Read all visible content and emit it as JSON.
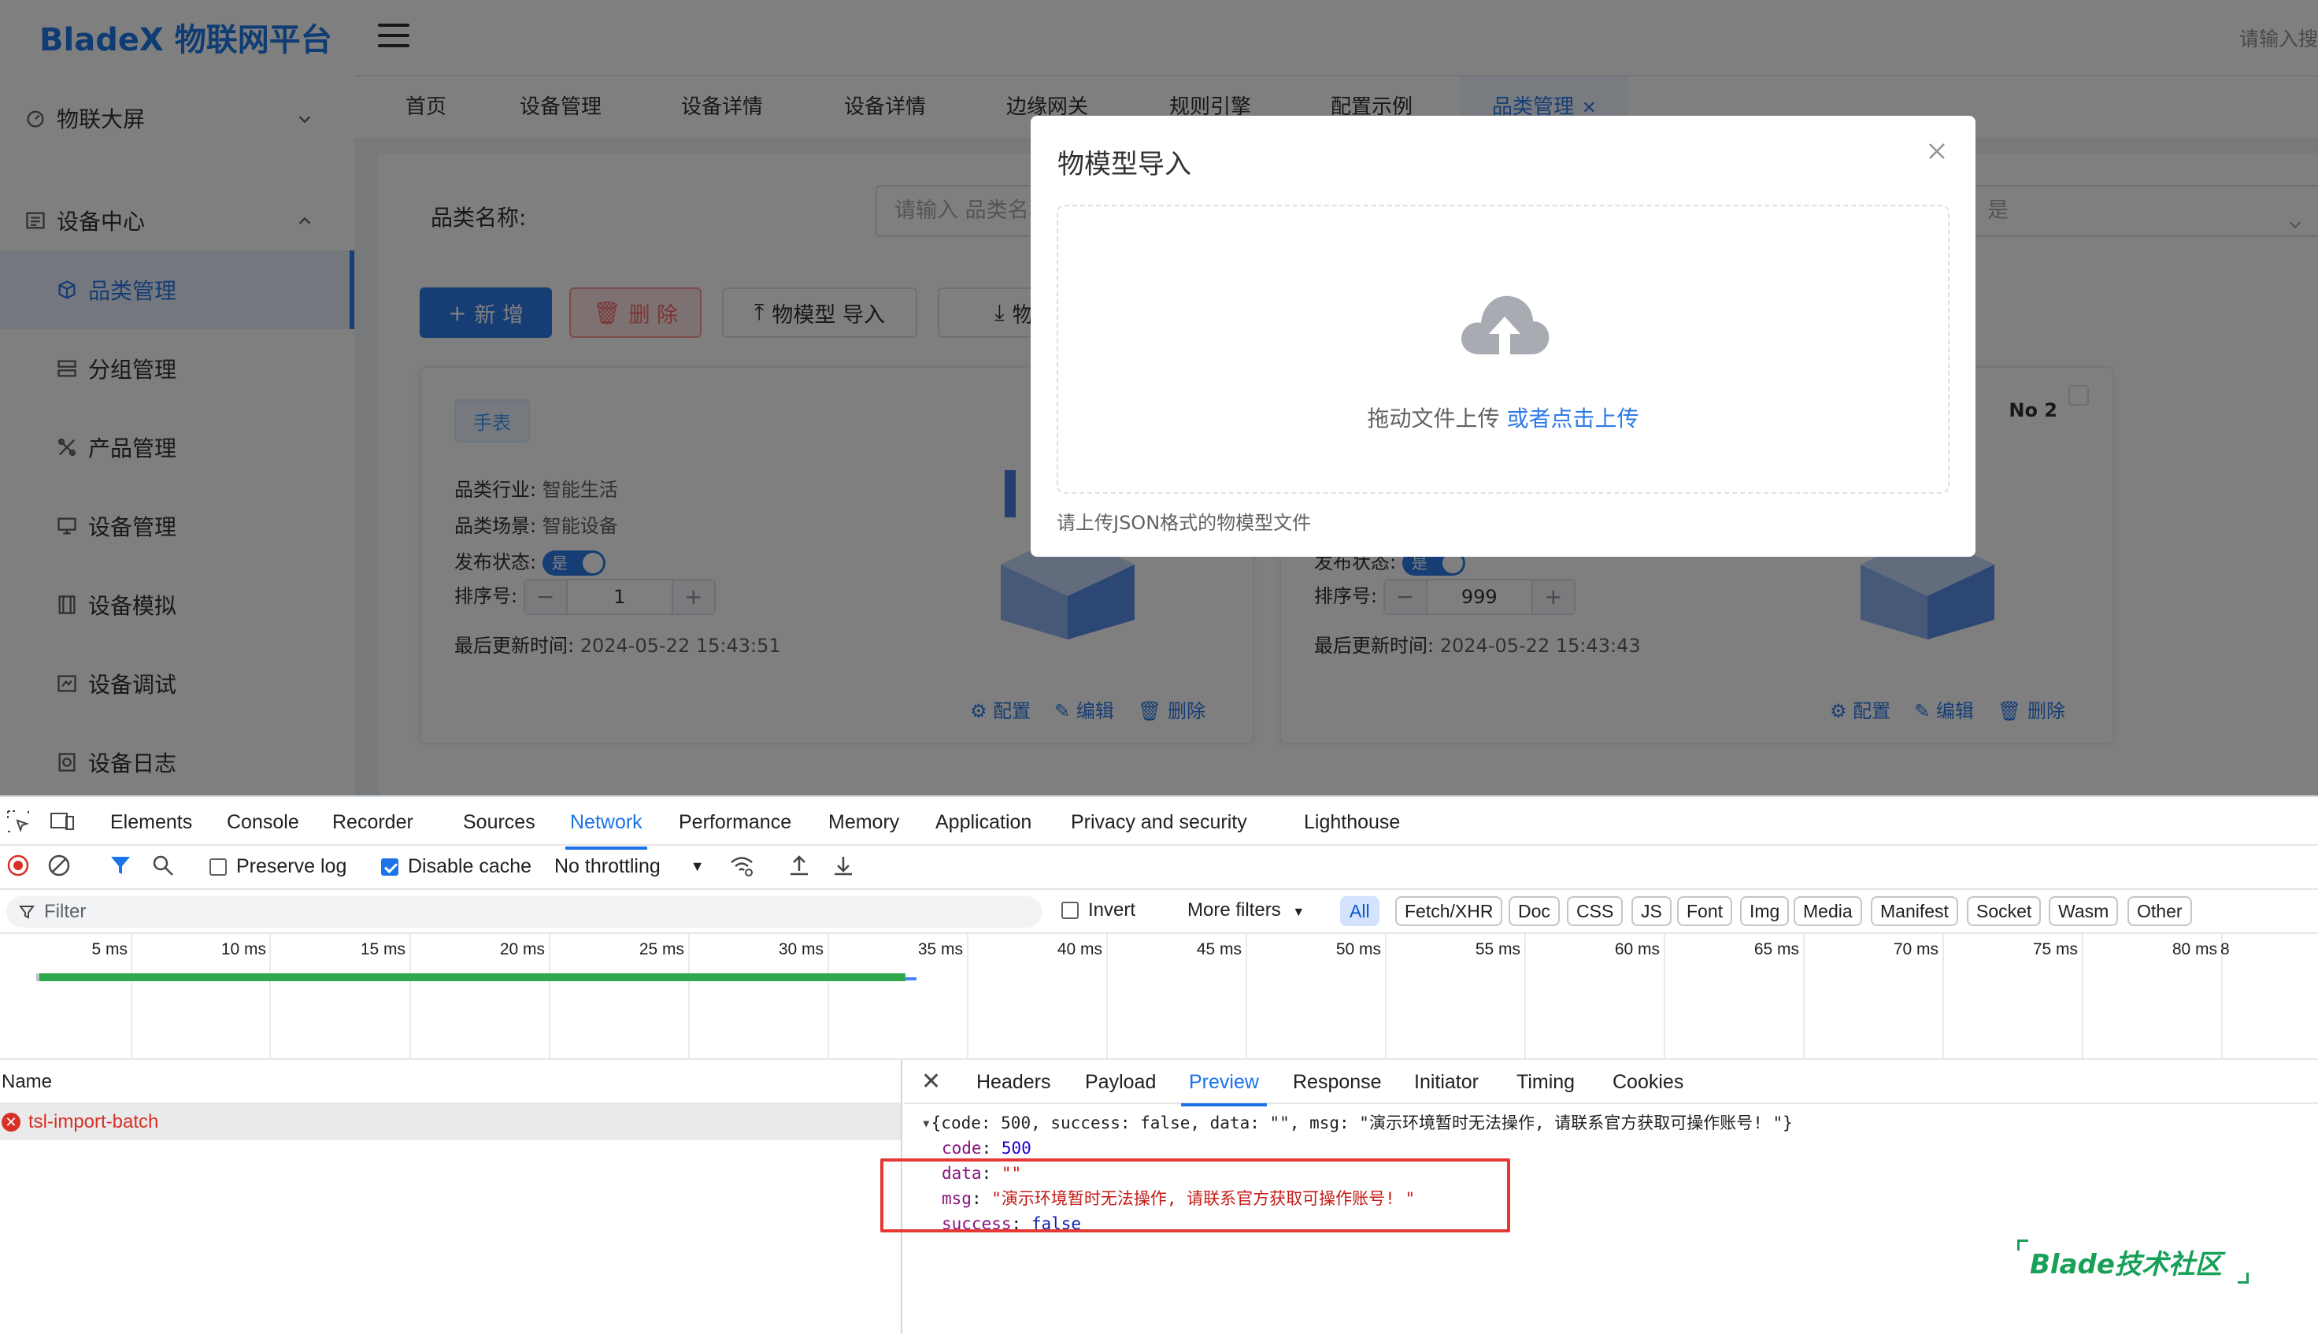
{
  "app": {
    "logo": "BladeX 物联网平台",
    "top_search_placeholder": "请输入搜",
    "sidebar": {
      "groups": [
        {
          "label": "物联大屏",
          "icon": "dashboard-icon",
          "expanded": false
        },
        {
          "label": "设备中心",
          "icon": "list-icon",
          "expanded": true
        }
      ],
      "items": [
        {
          "label": "品类管理",
          "icon": "cube-icon",
          "active": true
        },
        {
          "label": "分组管理",
          "icon": "group-icon",
          "active": false
        },
        {
          "label": "产品管理",
          "icon": "tools-icon",
          "active": false
        },
        {
          "label": "设备管理",
          "icon": "monitor-icon",
          "active": false
        },
        {
          "label": "设备模拟",
          "icon": "simulate-icon",
          "active": false
        },
        {
          "label": "设备调试",
          "icon": "debug-icon",
          "active": false
        },
        {
          "label": "设备日志",
          "icon": "log-icon",
          "active": false
        }
      ]
    },
    "tabs": [
      "首页",
      "设备管理",
      "设备详情",
      "设备详情",
      "边缘网关",
      "规则引擎",
      "配置示例",
      "品类管理"
    ],
    "active_tab": "品类管理",
    "search": {
      "label": "品类名称:",
      "placeholder": "请输入 品类名称",
      "right_placeholder": "是"
    },
    "toolbar": {
      "add": "新 增",
      "delete": "删 除",
      "import": "物模型 导入",
      "export": "物模型"
    },
    "cards": [
      {
        "badge": "手表",
        "industry_label": "品类行业:",
        "industry": "智能生活",
        "scene_label": "品类场景:",
        "scene": "智能设备",
        "status_label": "发布状态:",
        "status": "是",
        "sort_label": "排序号:",
        "sort": "1",
        "updated_label": "最后更新时间:",
        "updated": "2024-05-22 15:43:51",
        "actions": [
          "配置",
          "编辑",
          "删除"
        ]
      },
      {
        "no": "No 2",
        "status_label": "发布状态:",
        "status": "是",
        "sort_label": "排序号:",
        "sort": "999",
        "updated_label": "最后更新时间:",
        "updated": "2024-05-22 15:43:43",
        "actions": [
          "配置",
          "编辑",
          "删除"
        ]
      }
    ]
  },
  "dialog": {
    "title": "物模型导入",
    "drop_text": "拖动文件上传",
    "drop_link": "或者点击上传",
    "tip": "请上传JSON格式的物模型文件"
  },
  "devtools": {
    "main_tabs": [
      "Elements",
      "Console",
      "Recorder",
      "Sources",
      "Network",
      "Performance",
      "Memory",
      "Application",
      "Privacy and security",
      "Lighthouse"
    ],
    "active_main_tab": "Network",
    "toolbar": {
      "preserve_log": "Preserve log",
      "preserve_log_checked": false,
      "disable_cache": "Disable cache",
      "disable_cache_checked": true,
      "throttling": "No throttling"
    },
    "filter": {
      "placeholder": "Filter",
      "invert": "Invert",
      "more_filters": "More filters",
      "types": [
        "All",
        "Fetch/XHR",
        "Doc",
        "CSS",
        "JS",
        "Font",
        "Img",
        "Media",
        "Manifest",
        "Socket",
        "Wasm",
        "Other"
      ],
      "active_type": "All"
    },
    "timeline_ticks": [
      "5 ms",
      "10 ms",
      "15 ms",
      "20 ms",
      "25 ms",
      "30 ms",
      "35 ms",
      "40 ms",
      "45 ms",
      "50 ms",
      "55 ms",
      "60 ms",
      "65 ms",
      "70 ms",
      "75 ms",
      "80 ms",
      "8"
    ],
    "name_header": "Name",
    "request": "tsl-import-batch",
    "detail_tabs": [
      "Headers",
      "Payload",
      "Preview",
      "Response",
      "Initiator",
      "Timing",
      "Cookies"
    ],
    "active_detail_tab": "Preview",
    "preview": {
      "summary": "{code: 500, success: false, data: \"\", msg: \"演示环境暂时无法操作, 请联系官方获取可操作账号! \"}",
      "code_key": "code",
      "code": "500",
      "data_key": "data",
      "data": "\"\"",
      "msg_key": "msg",
      "msg": "\"演示环境暂时无法操作, 请联系官方获取可操作账号! \"",
      "success_key": "success",
      "success": "false"
    }
  },
  "watermark": "Blade技术社区",
  "colors": {
    "primary": "#2d7ae8",
    "danger": "#f56c6c",
    "devtools_active": "#1a73e8",
    "error": "#d93025",
    "highlight_box": "#e53935"
  }
}
